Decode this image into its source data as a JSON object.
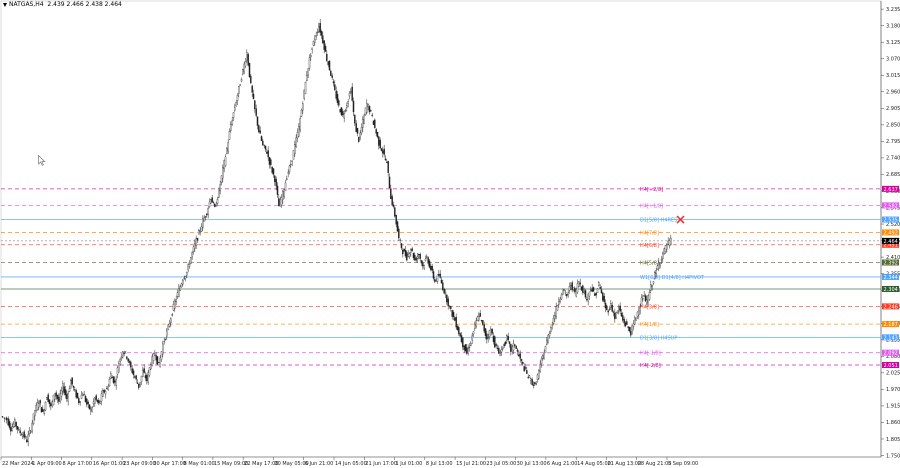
{
  "chart_data": {
    "type": "candlestick",
    "symbol_label": "NATGAS,H4",
    "ohlc_readout": "2.439 2.466 2.438 2.464",
    "current_price": "2.464",
    "y_ticks": [
      "3.235",
      "3.180",
      "3.125",
      "3.070",
      "3.015",
      "2.960",
      "2.905",
      "2.850",
      "2.795",
      "2.740",
      "2.685",
      "2.630",
      "2.575",
      "2.520",
      "2.465",
      "2.410",
      "2.355",
      "2.300",
      "2.245",
      "2.190",
      "2.135",
      "2.080",
      "2.025",
      "1.970",
      "1.915",
      "1.860",
      "1.805",
      "1.750"
    ],
    "ylim": [
      1.745,
      3.262
    ],
    "x_ticks": [
      "22 Mar 2024",
      "1 Apr 09:00",
      "8 Apr 17:00",
      "16 Apr 01:00",
      "23 Apr 09:00",
      "30 Apr 17:00",
      "8 May 01:00",
      "15 May 09:00",
      "22 May 17:00",
      "30 May 05:00",
      "6 Jun 21:00",
      "14 Jun 05:00",
      "21 Jun 17:00",
      "1 Jul 01:00",
      "8 Jul 13:00",
      "15 Jul 21:00",
      "23 Jul 05:00",
      "30 Jul 13:00",
      "6 Aug 21:00",
      "14 Aug 05:00",
      "21 Aug 13:00",
      "28 Aug 21:00",
      "5 Sep 09:00"
    ],
    "price_path": [
      [
        0,
        1.88
      ],
      [
        6,
        1.87
      ],
      [
        10,
        1.84
      ],
      [
        14,
        1.86
      ],
      [
        18,
        1.83
      ],
      [
        22,
        1.82
      ],
      [
        26,
        1.8
      ],
      [
        30,
        1.84
      ],
      [
        34,
        1.9
      ],
      [
        38,
        1.93
      ],
      [
        42,
        1.89
      ],
      [
        46,
        1.95
      ],
      [
        50,
        1.91
      ],
      [
        54,
        1.96
      ],
      [
        58,
        1.93
      ],
      [
        62,
        1.98
      ],
      [
        66,
        1.94
      ],
      [
        70,
        2.0
      ],
      [
        74,
        1.96
      ],
      [
        78,
        1.93
      ],
      [
        82,
        1.96
      ],
      [
        86,
        1.92
      ],
      [
        90,
        1.9
      ],
      [
        94,
        1.94
      ],
      [
        98,
        1.92
      ],
      [
        102,
        1.96
      ],
      [
        106,
        1.97
      ],
      [
        110,
        2.02
      ],
      [
        114,
        1.99
      ],
      [
        118,
        2.06
      ],
      [
        122,
        2.1
      ],
      [
        126,
        2.08
      ],
      [
        130,
        2.04
      ],
      [
        134,
        2.01
      ],
      [
        138,
        1.98
      ],
      [
        142,
        2.03
      ],
      [
        146,
        2.0
      ],
      [
        150,
        2.06
      ],
      [
        154,
        2.09
      ],
      [
        158,
        2.05
      ],
      [
        162,
        2.12
      ],
      [
        166,
        2.16
      ],
      [
        170,
        2.21
      ],
      [
        174,
        2.26
      ],
      [
        178,
        2.3
      ],
      [
        182,
        2.34
      ],
      [
        186,
        2.36
      ],
      [
        190,
        2.41
      ],
      [
        194,
        2.45
      ],
      [
        198,
        2.49
      ],
      [
        202,
        2.53
      ],
      [
        206,
        2.56
      ],
      [
        210,
        2.61
      ],
      [
        214,
        2.57
      ],
      [
        218,
        2.63
      ],
      [
        222,
        2.7
      ],
      [
        226,
        2.77
      ],
      [
        230,
        2.85
      ],
      [
        234,
        2.91
      ],
      [
        238,
        2.97
      ],
      [
        242,
        3.03
      ],
      [
        246,
        3.09
      ],
      [
        250,
        2.98
      ],
      [
        254,
        2.9
      ],
      [
        258,
        2.83
      ],
      [
        262,
        2.78
      ],
      [
        266,
        2.76
      ],
      [
        270,
        2.71
      ],
      [
        274,
        2.67
      ],
      [
        278,
        2.58
      ],
      [
        282,
        2.62
      ],
      [
        286,
        2.68
      ],
      [
        290,
        2.72
      ],
      [
        294,
        2.78
      ],
      [
        298,
        2.84
      ],
      [
        302,
        2.93
      ],
      [
        306,
        3.02
      ],
      [
        310,
        3.09
      ],
      [
        314,
        3.14
      ],
      [
        318,
        3.18
      ],
      [
        322,
        3.13
      ],
      [
        326,
        3.07
      ],
      [
        330,
        3.02
      ],
      [
        334,
        2.96
      ],
      [
        338,
        2.91
      ],
      [
        342,
        2.88
      ],
      [
        346,
        2.92
      ],
      [
        350,
        2.97
      ],
      [
        354,
        2.85
      ],
      [
        358,
        2.8
      ],
      [
        362,
        2.86
      ],
      [
        366,
        2.92
      ],
      [
        370,
        2.89
      ],
      [
        374,
        2.84
      ],
      [
        378,
        2.79
      ],
      [
        382,
        2.76
      ],
      [
        386,
        2.72
      ],
      [
        390,
        2.61
      ],
      [
        394,
        2.55
      ],
      [
        398,
        2.47
      ],
      [
        402,
        2.43
      ],
      [
        406,
        2.41
      ],
      [
        410,
        2.44
      ],
      [
        414,
        2.4
      ],
      [
        418,
        2.42
      ],
      [
        422,
        2.38
      ],
      [
        426,
        2.41
      ],
      [
        430,
        2.37
      ],
      [
        434,
        2.33
      ],
      [
        438,
        2.35
      ],
      [
        442,
        2.31
      ],
      [
        446,
        2.27
      ],
      [
        450,
        2.23
      ],
      [
        454,
        2.2
      ],
      [
        458,
        2.16
      ],
      [
        462,
        2.12
      ],
      [
        466,
        2.09
      ],
      [
        470,
        2.13
      ],
      [
        474,
        2.18
      ],
      [
        478,
        2.22
      ],
      [
        482,
        2.18
      ],
      [
        486,
        2.14
      ],
      [
        490,
        2.17
      ],
      [
        494,
        2.12
      ],
      [
        498,
        2.09
      ],
      [
        502,
        2.11
      ],
      [
        506,
        2.14
      ],
      [
        510,
        2.1
      ],
      [
        514,
        2.12
      ],
      [
        518,
        2.08
      ],
      [
        522,
        2.05
      ],
      [
        526,
        2.02
      ],
      [
        530,
        2.0
      ],
      [
        534,
        1.98
      ],
      [
        538,
        2.03
      ],
      [
        542,
        2.08
      ],
      [
        546,
        2.13
      ],
      [
        550,
        2.18
      ],
      [
        554,
        2.22
      ],
      [
        558,
        2.27
      ],
      [
        562,
        2.3
      ],
      [
        566,
        2.28
      ],
      [
        570,
        2.32
      ],
      [
        574,
        2.29
      ],
      [
        578,
        2.33
      ],
      [
        582,
        2.3
      ],
      [
        586,
        2.27
      ],
      [
        590,
        2.31
      ],
      [
        594,
        2.28
      ],
      [
        598,
        2.32
      ],
      [
        602,
        2.27
      ],
      [
        606,
        2.23
      ],
      [
        610,
        2.25
      ],
      [
        614,
        2.21
      ],
      [
        618,
        2.24
      ],
      [
        622,
        2.2
      ],
      [
        626,
        2.18
      ],
      [
        630,
        2.16
      ],
      [
        634,
        2.2
      ],
      [
        638,
        2.24
      ],
      [
        642,
        2.28
      ],
      [
        646,
        2.26
      ],
      [
        650,
        2.31
      ],
      [
        654,
        2.35
      ],
      [
        658,
        2.39
      ],
      [
        662,
        2.42
      ],
      [
        666,
        2.45
      ],
      [
        670,
        2.464
      ]
    ],
    "levels": [
      {
        "label": "H4[+2/8]",
        "price": "2.637",
        "value": 2.637,
        "color": "#d6009e",
        "dashed": true
      },
      {
        "label": "H4[+1/8]",
        "price": "2.582",
        "value": 2.582,
        "color": "#e05af0",
        "dashed": true
      },
      {
        "label": "D1[5/8] H4RES",
        "price": "2.535",
        "value": 2.535,
        "color": "#4da3ff",
        "dashed": false
      },
      {
        "label": "H4[7/8]",
        "price": "2.492",
        "value": 2.492,
        "color": "#ff8c00",
        "dashed": true
      },
      {
        "label": "H4[6/8]",
        "price": "2.451",
        "value": 2.451,
        "color": "#ff3b1f",
        "dashed": true
      },
      {
        "label": "H4[5/8]",
        "price": "2.392",
        "value": 2.392,
        "color": "#556b2f",
        "dashed": true
      },
      {
        "label": "W1[6/8] D1[4/8] H4PIVOT",
        "price": "2.344",
        "value": 2.344,
        "color": "#4da3ff",
        "dashed": false
      },
      {
        "label": "",
        "price": "2.304",
        "value": 2.304,
        "color": "#2e5e2e",
        "dashed": false
      },
      {
        "label": "H4[3/8]",
        "price": "2.246",
        "value": 2.246,
        "color": "#ff3b1f",
        "dashed": true
      },
      {
        "label": "H4[1/8]",
        "price": "2.187",
        "value": 2.187,
        "color": "#ff8c00",
        "dashed": true
      },
      {
        "label": "D1[3/8] H4SUP",
        "price": "2.143",
        "value": 2.143,
        "color": "#4da3ff",
        "dashed": false
      },
      {
        "label": "H4[-1/8]",
        "price": "2.092",
        "value": 2.092,
        "color": "#e05af0",
        "dashed": true
      },
      {
        "label": "H4[-2/8]",
        "price": "2.051",
        "value": 2.051,
        "color": "#d6009e",
        "dashed": true
      }
    ],
    "marker": {
      "type": "cross",
      "value": 2.535,
      "color": "#e53935"
    }
  }
}
